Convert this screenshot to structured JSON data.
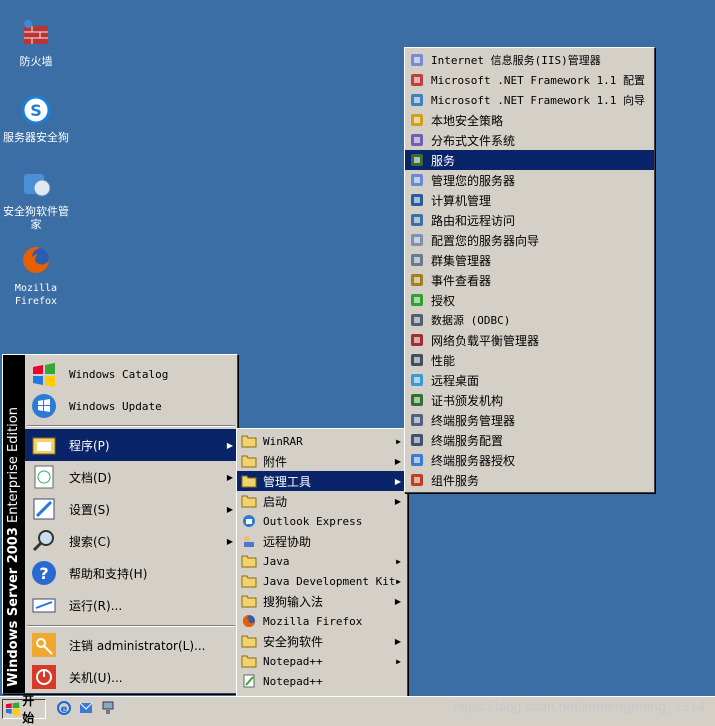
{
  "desktop": {
    "icons": [
      {
        "label": "防火墙",
        "icon": "firewall-icon"
      },
      {
        "label": "服务器安全狗",
        "icon": "safedog-server-icon"
      },
      {
        "label": "安全狗软件管家",
        "icon": "safedog-software-icon"
      },
      {
        "label": "Mozilla Firefox",
        "icon": "firefox-icon"
      }
    ]
  },
  "start_menu": {
    "brand_bold": "Windows Server 2003",
    "brand_light": " Enterprise Edition",
    "pinned": [
      {
        "label": "Windows Catalog",
        "icon": "windows-catalog-icon"
      },
      {
        "label": "Windows Update",
        "icon": "windows-update-icon"
      }
    ],
    "items": [
      {
        "label": "程序(P)",
        "icon": "programs-icon",
        "arrow": true
      },
      {
        "label": "文档(D)",
        "icon": "documents-icon",
        "arrow": true
      },
      {
        "label": "设置(S)",
        "icon": "settings-icon",
        "arrow": true
      },
      {
        "label": "搜索(C)",
        "icon": "search-icon",
        "arrow": true
      },
      {
        "label": "帮助和支持(H)",
        "icon": "help-icon",
        "arrow": false
      },
      {
        "label": "运行(R)...",
        "icon": "run-icon",
        "arrow": false
      }
    ],
    "logoff": {
      "label": "注销 administrator(L)...",
      "icon": "logoff-icon"
    },
    "shutdown": {
      "label": "关机(U)...",
      "icon": "shutdown-icon"
    }
  },
  "programs_menu": {
    "items": [
      {
        "label": "WinRAR",
        "icon": "folder-icon",
        "arrow": true
      },
      {
        "label": "附件",
        "icon": "folder-icon",
        "arrow": true
      },
      {
        "label": "管理工具",
        "icon": "folder-icon",
        "arrow": true
      },
      {
        "label": "启动",
        "icon": "folder-icon",
        "arrow": true
      },
      {
        "label": "Outlook Express",
        "icon": "outlook-express-icon",
        "arrow": false
      },
      {
        "label": "远程协助",
        "icon": "remote-assistance-icon",
        "arrow": false
      },
      {
        "label": "Java",
        "icon": "folder-icon",
        "arrow": true
      },
      {
        "label": "Java Development Kit",
        "icon": "folder-icon",
        "arrow": true
      },
      {
        "label": "搜狗输入法",
        "icon": "folder-icon",
        "arrow": true
      },
      {
        "label": "Mozilla Firefox",
        "icon": "firefox-icon",
        "arrow": false
      },
      {
        "label": "安全狗软件",
        "icon": "folder-icon",
        "arrow": true
      },
      {
        "label": "Notepad++",
        "icon": "folder-icon",
        "arrow": true
      },
      {
        "label": "Notepad++",
        "icon": "notepadpp-icon",
        "arrow": false
      }
    ],
    "more": "⌄⌄"
  },
  "admin_tools_menu": {
    "items": [
      {
        "label": "Internet 信息服务(IIS)管理器",
        "icon": "iis-icon"
      },
      {
        "label": "Microsoft .NET Framework 1.1 配置",
        "icon": "dotnet-config-icon"
      },
      {
        "label": "Microsoft .NET Framework 1.1 向导",
        "icon": "dotnet-wizard-icon"
      },
      {
        "label": "本地安全策略",
        "icon": "security-policy-icon"
      },
      {
        "label": "分布式文件系统",
        "icon": "dfs-icon"
      },
      {
        "label": "服务",
        "icon": "services-icon"
      },
      {
        "label": "管理您的服务器",
        "icon": "manage-server-icon"
      },
      {
        "label": "计算机管理",
        "icon": "computer-management-icon"
      },
      {
        "label": "路由和远程访问",
        "icon": "routing-icon"
      },
      {
        "label": "配置您的服务器向导",
        "icon": "configure-server-icon"
      },
      {
        "label": "群集管理器",
        "icon": "cluster-icon"
      },
      {
        "label": "事件查看器",
        "icon": "event-viewer-icon"
      },
      {
        "label": "授权",
        "icon": "licensing-icon"
      },
      {
        "label": "数据源 (ODBC)",
        "icon": "odbc-icon"
      },
      {
        "label": "网络负载平衡管理器",
        "icon": "nlb-icon"
      },
      {
        "label": "性能",
        "icon": "performance-icon"
      },
      {
        "label": "远程桌面",
        "icon": "remote-desktop-icon"
      },
      {
        "label": "证书颁发机构",
        "icon": "certificate-icon"
      },
      {
        "label": "终端服务管理器",
        "icon": "ts-manager-icon"
      },
      {
        "label": "终端服务配置",
        "icon": "ts-config-icon"
      },
      {
        "label": "终端服务器授权",
        "icon": "ts-licensing-icon"
      },
      {
        "label": "组件服务",
        "icon": "component-services-icon"
      }
    ]
  },
  "taskbar": {
    "start_label": "开始"
  },
  "watermark": "https://blog.csdn.net/linmengmeng_1314",
  "colors": {
    "desktop": "#3a6ea5",
    "menu": "#d4d0c8",
    "highlight": "#0a246a"
  }
}
